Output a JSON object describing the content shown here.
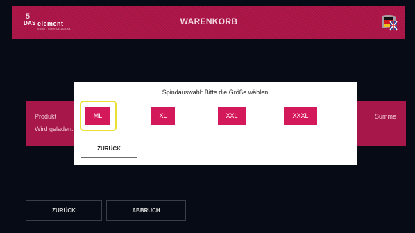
{
  "header": {
    "logo_das": "DAS",
    "logo_element": "element",
    "logo_tagline": "SMART SERVICE ZU LAB",
    "title": "WARENKORB",
    "language_icon": "flag-de-icon"
  },
  "cart": {
    "col_product": "Produkt",
    "loading": "Wird geladen.",
    "col_sum": "Summe"
  },
  "dialog": {
    "title": "Spindauswahl: Bitte die Größe wählen",
    "sizes": [
      "ML",
      "XL",
      "XXL",
      "XXXL"
    ],
    "selected_size": "ML",
    "back_label": "ZURÜCK"
  },
  "footer": {
    "back_label": "ZURÜCK",
    "cancel_label": "ABBRUCH"
  },
  "colors": {
    "accent": "#d4195a",
    "band": "#a8174a",
    "highlight": "#e8e033",
    "background": "#070b16"
  }
}
